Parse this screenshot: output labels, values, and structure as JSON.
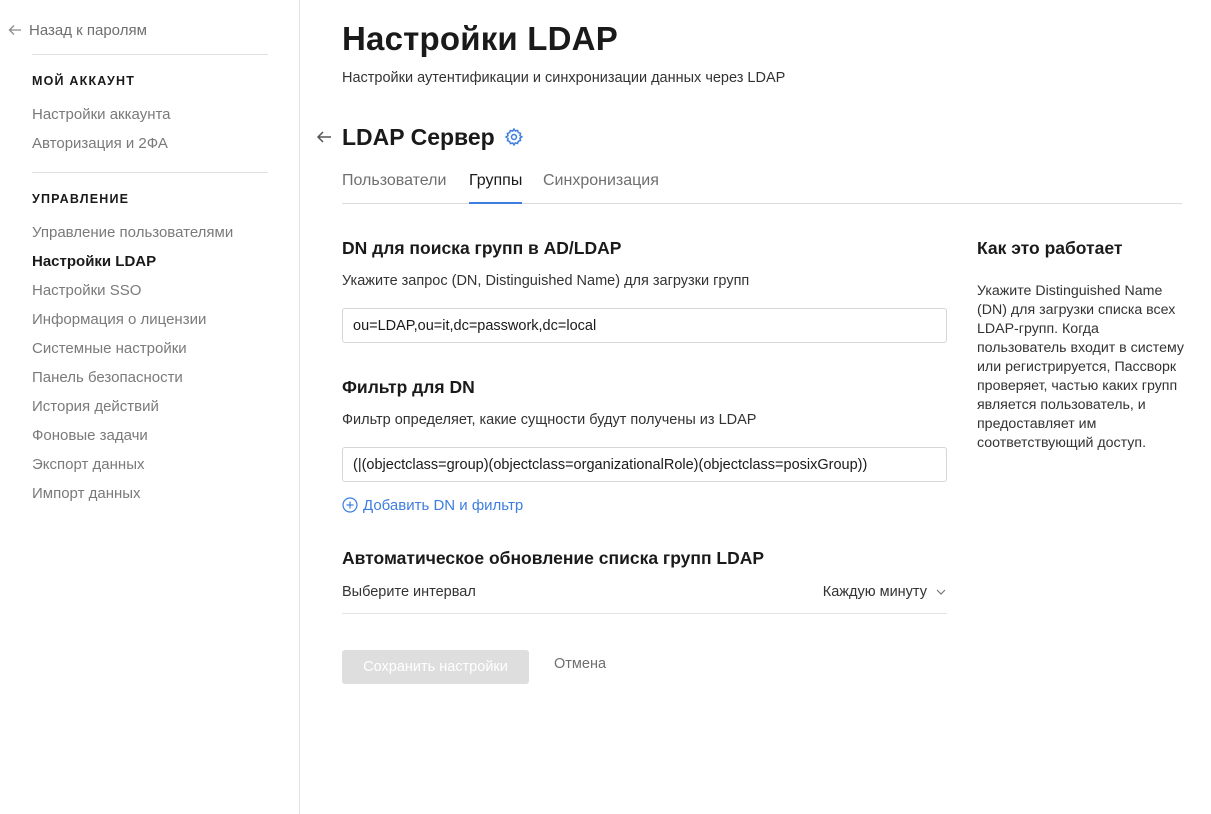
{
  "sidebar": {
    "back_label": "Назад к паролям",
    "sections": [
      {
        "title": "МОЙ АККАУНТ",
        "items": [
          {
            "label": "Настройки аккаунта"
          },
          {
            "label": "Авторизация и 2ФА"
          }
        ]
      },
      {
        "title": "УПРАВЛЕНИЕ",
        "items": [
          {
            "label": "Управление пользователями"
          },
          {
            "label": "Настройки LDAP",
            "active": true
          },
          {
            "label": "Настройки SSO"
          },
          {
            "label": "Информация о лицензии"
          },
          {
            "label": "Системные настройки"
          },
          {
            "label": "Панель безопасности"
          },
          {
            "label": "История действий"
          },
          {
            "label": "Фоновые задачи"
          },
          {
            "label": "Экспорт данных"
          },
          {
            "label": "Импорт данных"
          }
        ]
      }
    ]
  },
  "header": {
    "title": "Настройки LDAP",
    "subtitle": "Настройки аутентификации и синхронизации данных через LDAP"
  },
  "server": {
    "title": "LDAP Сервер",
    "settings_icon": "gear-icon"
  },
  "tabs": [
    {
      "label": "Пользователи"
    },
    {
      "label": "Группы",
      "active": true
    },
    {
      "label": "Синхронизация"
    }
  ],
  "groups": {
    "dn_section": {
      "title": "DN для поиска групп в AD/LDAP",
      "description": "Укажите запрос (DN, Distinguished Name) для загрузки групп",
      "value": "ou=LDAP,ou=it,dc=passwork,dc=local"
    },
    "filter_section": {
      "title": "Фильтр для DN",
      "description": "Фильтр определяет, какие сущности будут получены из LDAP",
      "value": "(|(objectclass=group)(objectclass=organizationalRole)(objectclass=posixGroup))"
    },
    "add_link": "Добавить DN и фильтр",
    "auto_update": {
      "title": "Автоматическое обновление списка групп LDAP",
      "interval_label": "Выберите интервал",
      "interval_value": "Каждую минуту"
    },
    "save_label": "Сохранить настройки",
    "cancel_label": "Отмена"
  },
  "help": {
    "title": "Как это работает",
    "text": "Укажите Distinguished Name (DN) для загрузки списка всех LDAP-групп. Когда пользователь входит в систему или регистрируется, Пассворк проверяет, частью каких групп является пользователь, и предоставляет им соответствующий доступ."
  },
  "colors": {
    "accent": "#3d7ee0",
    "text": "#1a1a1a",
    "muted": "#7a7a7a",
    "button_disabled": "#dedede"
  }
}
